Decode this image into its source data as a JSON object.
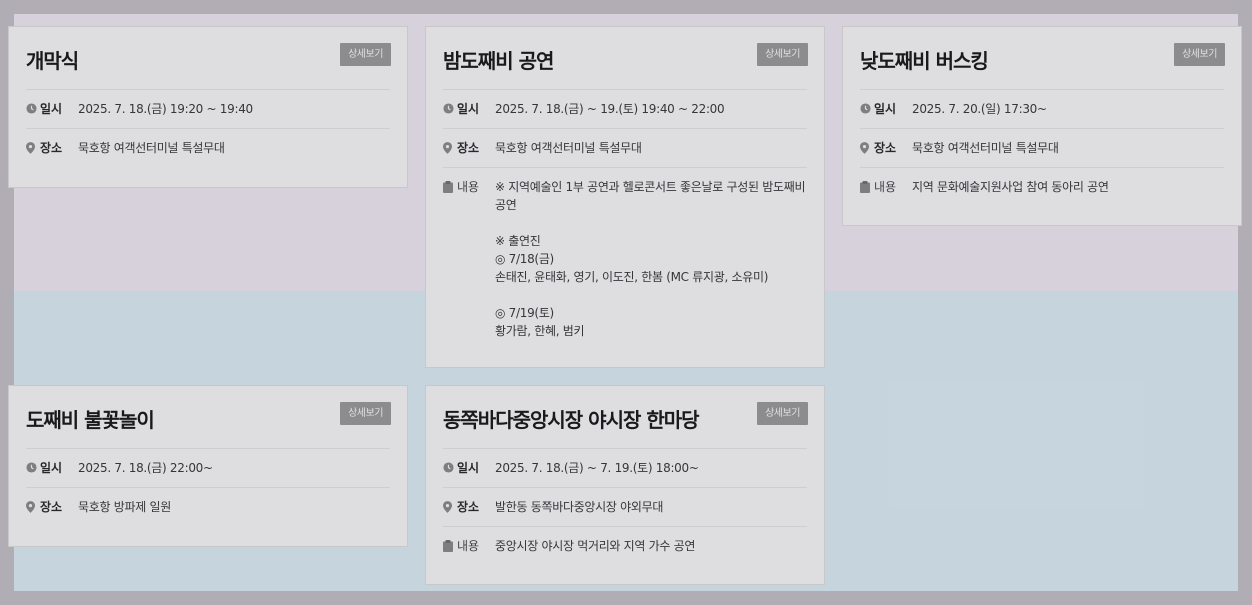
{
  "detail_label": "상세보기",
  "labels": {
    "date": "일시",
    "place": "장소",
    "content": "내용"
  },
  "events": [
    {
      "title": "개막식",
      "date": "2025. 7. 18.(금) 19:20 ~ 19:40",
      "place": "묵호항 여객선터미널 특설무대"
    },
    {
      "title": "밤도째비 공연",
      "date": "2025. 7. 18.(금) ~ 19.(토) 19:40 ~ 22:00",
      "place": "묵호항 여객선터미널 특설무대",
      "content": "※ 지역예술인 1부 공연과 헬로콘서트 좋은날로 구성된 밤도째비 공연\n\n※ 출연진\n◎ 7/18(금)\n손태진, 윤태화, 영기, 이도진, 한봄 (MC 류지광, 소유미)\n\n◎ 7/19(토)\n황가람, 한혜, 범키"
    },
    {
      "title": "낮도째비 버스킹",
      "date": "2025. 7. 20.(일) 17:30~",
      "place": "묵호항 여객선터미널 특설무대",
      "content": "지역 문화예술지원사업 참여 동아리 공연"
    },
    {
      "title": "도째비 불꽃놀이",
      "date": "2025. 7. 18.(금) 22:00~",
      "place": "묵호항 방파제 일원"
    },
    {
      "title": "동쪽바다중앙시장 야시장 한마당",
      "date": "2025. 7. 18.(금) ~ 7. 19.(토) 18:00~",
      "place": "발한동 동쪽바다중앙시장 야외무대",
      "content": "중앙시장 야시장 먹거리와 지역 가수 공연"
    }
  ]
}
